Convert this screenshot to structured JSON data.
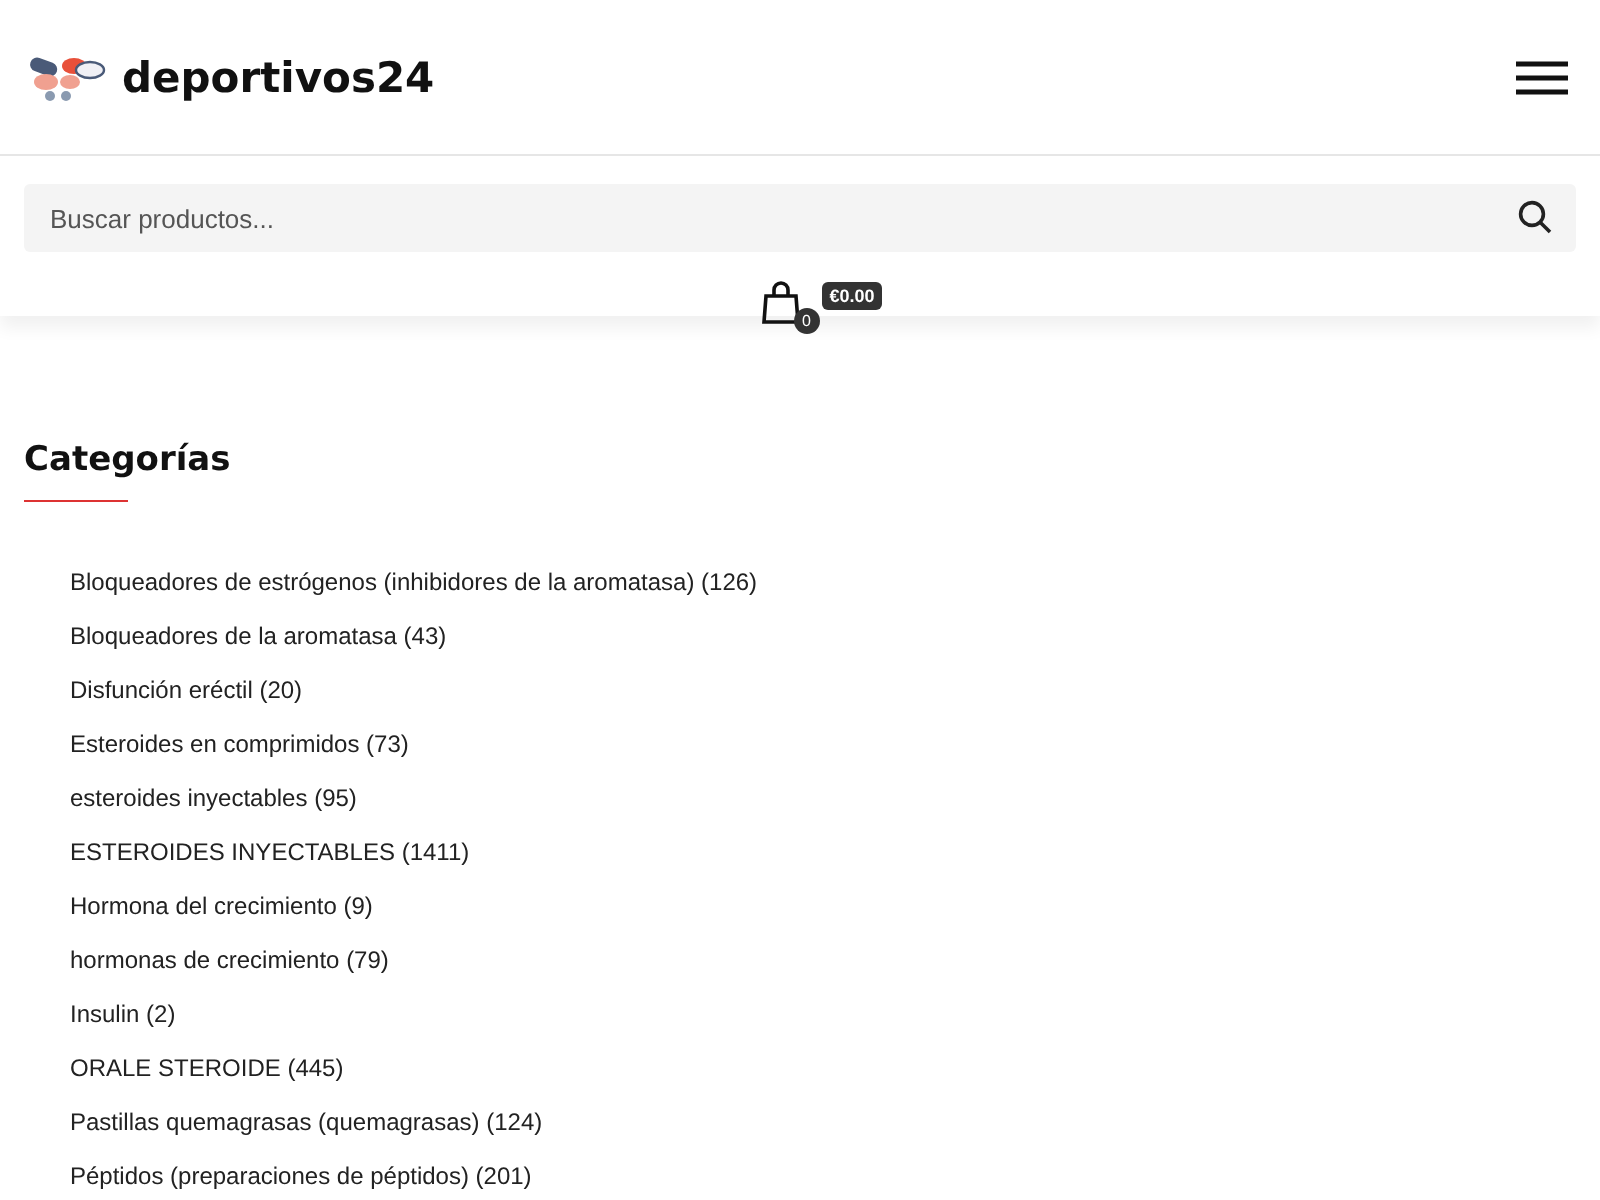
{
  "header": {
    "logo_text": "deportivos24"
  },
  "search": {
    "placeholder": "Buscar productos..."
  },
  "cart": {
    "count": "0",
    "total": "€0.00"
  },
  "categories": {
    "title": "Categorías",
    "items": [
      {
        "label": "Bloqueadores de estrógenos (inhibidores de la aromatasa) (126)"
      },
      {
        "label": "Bloqueadores de la aromatasa (43)"
      },
      {
        "label": "Disfunción eréctil (20)"
      },
      {
        "label": "Esteroides en comprimidos (73)"
      },
      {
        "label": "esteroides inyectables (95)"
      },
      {
        "label": "ESTEROIDES INYECTABLES (1411)"
      },
      {
        "label": "Hormona del crecimiento (9)"
      },
      {
        "label": "hormonas de crecimiento (79)"
      },
      {
        "label": "Insulin (2)"
      },
      {
        "label": "ORALE STEROIDE (445)"
      },
      {
        "label": "Pastillas quemagrasas (quemagrasas) (124)"
      },
      {
        "label": "Péptidos (preparaciones de péptidos) (201)"
      }
    ]
  }
}
